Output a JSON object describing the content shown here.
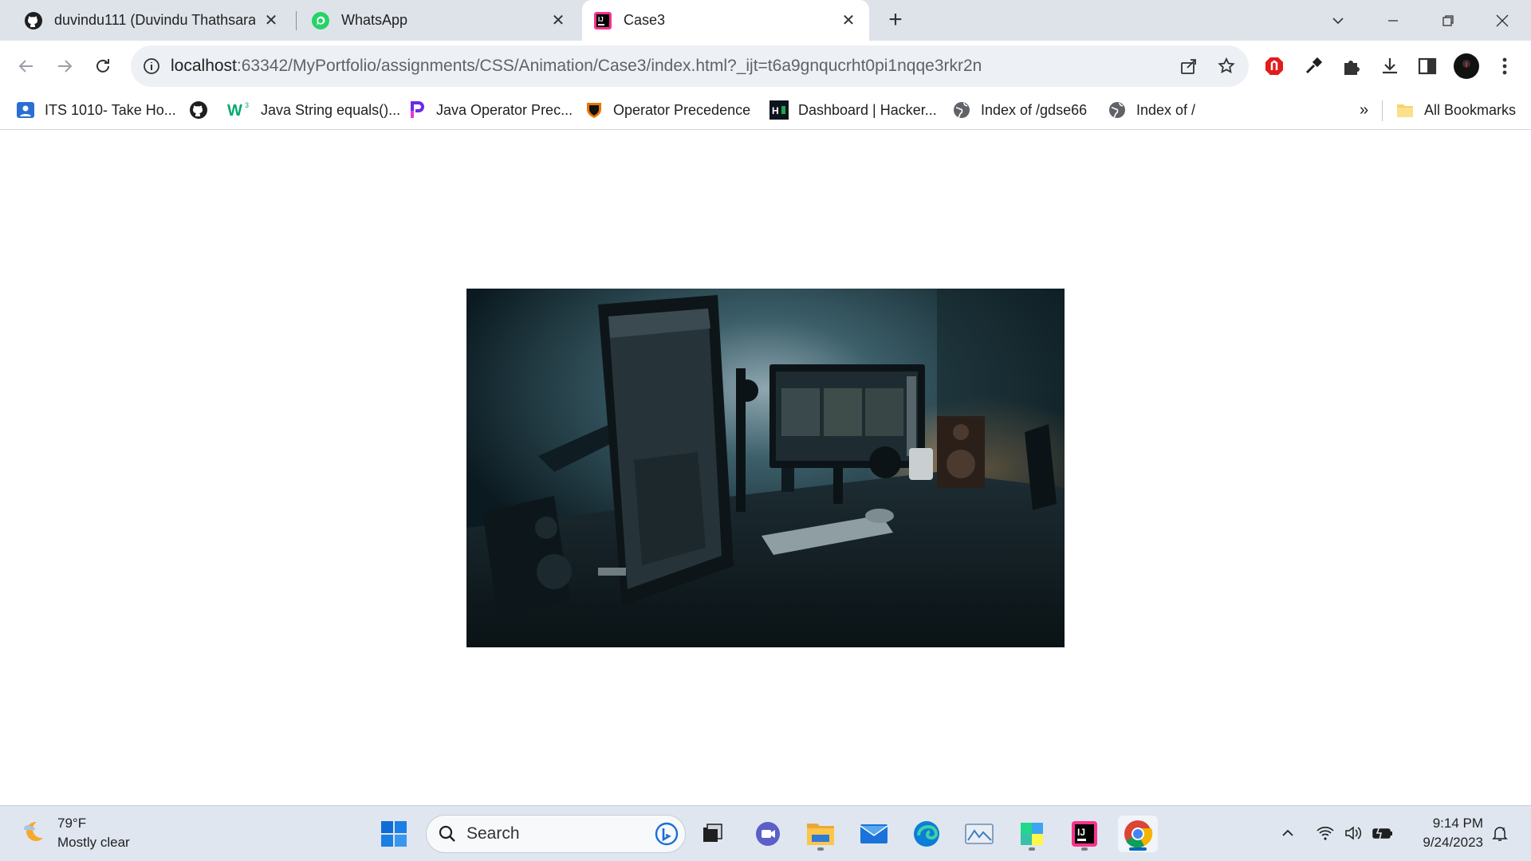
{
  "tabs": [
    {
      "title": "duvindu111 (Duvindu Thathsara)",
      "icon": "github-icon",
      "active": false
    },
    {
      "title": "WhatsApp",
      "icon": "whatsapp-icon",
      "active": false
    },
    {
      "title": "Case3",
      "icon": "intellij-icon",
      "active": true
    }
  ],
  "address": {
    "host": "localhost",
    "path": ":63342/MyPortfolio/assignments/CSS/Animation/Case3/index.html?_ijt=t6a9gnqucrht0pi1nqqe3rkr2n"
  },
  "bookmarks": [
    {
      "label": "ITS 1010- Take Ho...",
      "icon": "teams-icon"
    },
    {
      "label": "",
      "icon": "github-icon"
    },
    {
      "label": "Java String equals()...",
      "icon": "w3schools-icon"
    },
    {
      "label": "Java Operator Prec...",
      "icon": "programiz-icon"
    },
    {
      "label": "Operator Precedence",
      "icon": "princeton-icon"
    },
    {
      "label": "Dashboard | Hacker...",
      "icon": "hackerrank-icon"
    },
    {
      "label": "Index of /gdse66",
      "icon": "globe-icon"
    },
    {
      "label": "Index of /",
      "icon": "globe-icon"
    }
  ],
  "bookmarks_overflow": "»",
  "all_bookmarks": "All Bookmarks",
  "content": {
    "image_alt": "Desk setup with monitors in dim teal light"
  },
  "taskbar": {
    "weather_temp": "79°F",
    "weather_desc": "Mostly clear",
    "search_label": "Search",
    "time": "9:14 PM",
    "date": "9/24/2023"
  },
  "colors": {
    "tabstrip": "#dee3ea",
    "omnibox": "#edf0f4",
    "taskbar": "#dfe6ef",
    "chrome_indicator": "#0067c0"
  }
}
